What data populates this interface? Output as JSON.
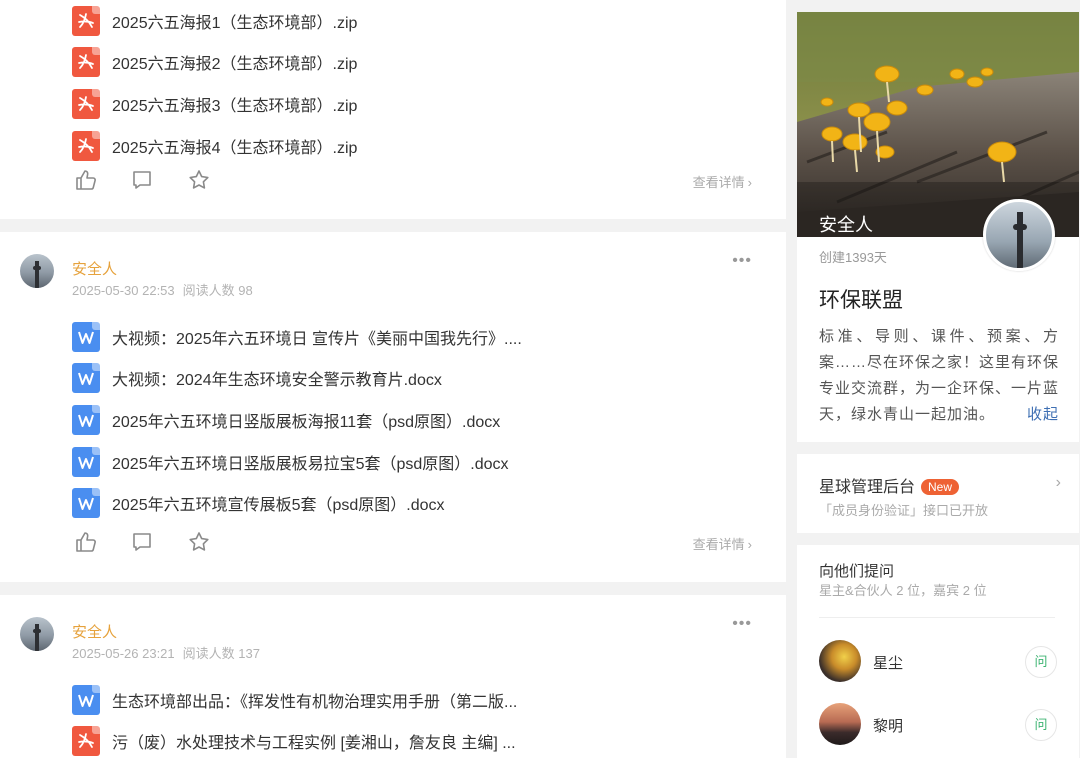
{
  "feed": {
    "cards": [
      {
        "files": [
          {
            "type": "pdf",
            "name": "2025六五海报1（生态环境部）.zip"
          },
          {
            "type": "pdf",
            "name": "2025六五海报2（生态环境部）.zip"
          },
          {
            "type": "pdf",
            "name": "2025六五海报3（生态环境部）.zip"
          },
          {
            "type": "pdf",
            "name": "2025六五海报4（生态环境部）.zip"
          }
        ],
        "view_detail": "查看详情"
      },
      {
        "author": "安全人",
        "date": "2025-05-30 22:53",
        "readers": "阅读人数 98",
        "files": [
          {
            "type": "word",
            "name": "大视频：2025年六五环境日 宣传片《美丽中国我先行》...."
          },
          {
            "type": "word",
            "name": "大视频：2024年生态环境安全警示教育片.docx"
          },
          {
            "type": "word",
            "name": "2025年六五环境日竖版展板海报11套（psd原图）.docx"
          },
          {
            "type": "word",
            "name": "2025年六五环境日竖版展板易拉宝5套（psd原图）.docx"
          },
          {
            "type": "word",
            "name": "2025年六五环境宣传展板5套（psd原图）.docx"
          }
        ],
        "view_detail": "查看详情"
      },
      {
        "author": "安全人",
        "date": "2025-05-26 23:21",
        "readers": "阅读人数 137",
        "files": [
          {
            "type": "word",
            "name": "生态环境部出品：《挥发性有机物治理实用手册（第二版..."
          },
          {
            "type": "pdf",
            "name": "污（废）水处理技术与工程实例 [姜湘山，詹友良 主编] ..."
          }
        ]
      }
    ]
  },
  "sidebar": {
    "profile": {
      "cover_name": "安全人",
      "created": "创建1393天",
      "group_title": "环保联盟",
      "description": "标准、导则、课件、预案、方案……尽在环保之家！这里有环保专业交流群，为一企环保、一片蓝天，绿水青山一起加油。",
      "collapse": "收起"
    },
    "admin": {
      "title": "星球管理后台",
      "badge": "New",
      "subtitle": "「成员身份验证」接口已开放"
    },
    "ask": {
      "title": "向他们提问",
      "subtitle": "星主&合伙人 2 位，嘉宾 2 位",
      "members": [
        {
          "name": "星尘",
          "button": "问"
        },
        {
          "name": "黎明",
          "button": "问"
        }
      ]
    }
  },
  "colors": {
    "author": "#e6a23c",
    "pdf": "#f0583f",
    "word": "#4a8ef0",
    "new_badge": "#ee6234",
    "ask_button": "#3cb371",
    "link": "#3e6fb3"
  }
}
